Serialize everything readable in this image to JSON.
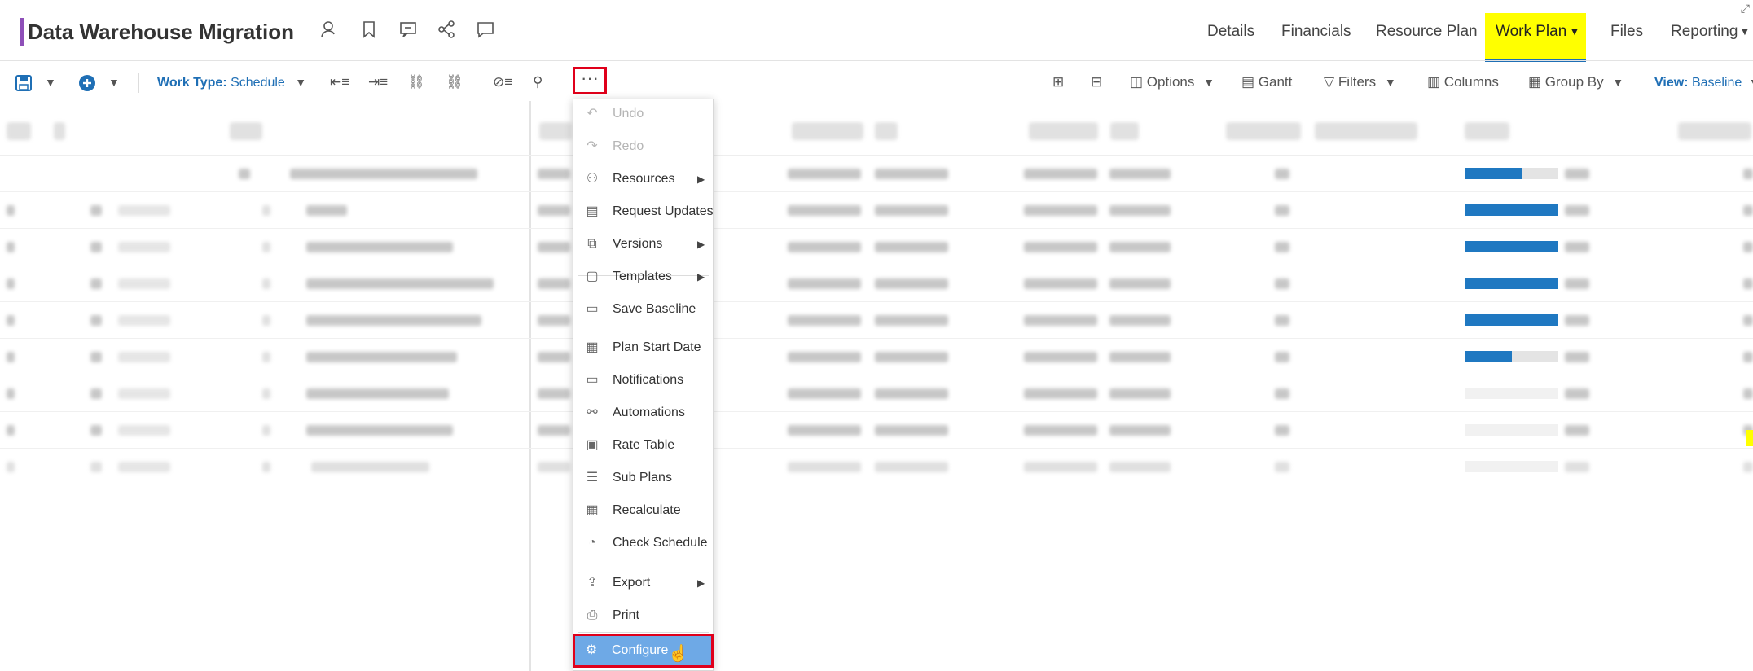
{
  "header": {
    "title": "Data Warehouse Migration",
    "icons": [
      "user-icon",
      "bookmark-icon",
      "comment-icon",
      "share-icon",
      "chat-icon"
    ],
    "nav": [
      "Details",
      "Financials",
      "Resource Plan",
      "Work Plan",
      "Files",
      "Reporting"
    ],
    "active_nav": "Work Plan"
  },
  "toolbar": {
    "work_type_label": "Work Type:",
    "work_type_value": "Schedule",
    "options": "Options",
    "gantt": "Gantt",
    "filters": "Filters",
    "columns": "Columns",
    "group_by": "Group By",
    "view_label": "View:",
    "view_value": "Baseline",
    "more": "···"
  },
  "menu": {
    "items": [
      {
        "label": "Undo",
        "icon": "undo-icon",
        "disabled": true
      },
      {
        "label": "Redo",
        "icon": "redo-icon",
        "disabled": true
      },
      {
        "label": "Resources",
        "icon": "resources-icon",
        "submenu": true
      },
      {
        "label": "Request Updates",
        "icon": "request-updates-icon"
      },
      {
        "label": "Versions",
        "icon": "versions-icon",
        "submenu": true
      },
      {
        "label": "Templates",
        "icon": "templates-icon",
        "submenu": true
      },
      {
        "label": "Save Baseline",
        "icon": "save-baseline-icon"
      },
      {
        "label": "Plan Start Date",
        "icon": "calendar-icon"
      },
      {
        "label": "Notifications",
        "icon": "notifications-icon"
      },
      {
        "label": "Automations",
        "icon": "automations-icon"
      },
      {
        "label": "Rate Table",
        "icon": "rate-table-icon"
      },
      {
        "label": "Sub Plans",
        "icon": "sub-plans-icon"
      },
      {
        "label": "Recalculate",
        "icon": "calculator-icon"
      },
      {
        "label": "Check Schedule",
        "icon": "check-schedule-icon"
      },
      {
        "label": "Export",
        "icon": "export-icon",
        "submenu": true
      },
      {
        "label": "Print",
        "icon": "print-icon"
      },
      {
        "label": "Configure",
        "icon": "configure-icon",
        "highlighted": true
      }
    ]
  },
  "progress": [
    0.62,
    1.0,
    1.0,
    1.0,
    1.0,
    0.5,
    0.0,
    0.0,
    0.0
  ],
  "colors": {
    "accent": "#1f6fb5",
    "highlight": "#ffff00",
    "menu_selected": "#6ea9e6",
    "annotation_red": "#e0001b",
    "title_bar": "#8e4fb8"
  }
}
